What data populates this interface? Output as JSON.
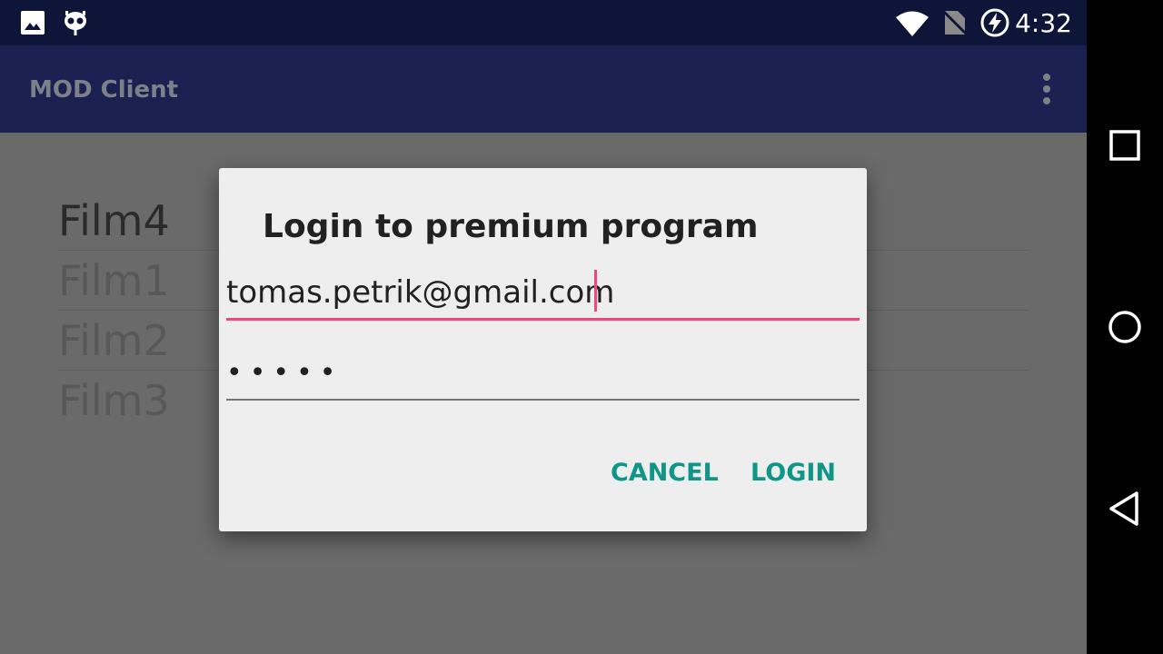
{
  "status_bar": {
    "time": "4:32",
    "icons": [
      "image-icon",
      "cyanogen-icon",
      "wifi-icon",
      "no-sim-icon",
      "battery-charging-icon"
    ]
  },
  "app_bar": {
    "title": "MOD Client",
    "menu_icon": "overflow-menu-icon"
  },
  "film_list": {
    "items": [
      "Film4",
      "Film1",
      "Film2",
      "Film3"
    ]
  },
  "dialog": {
    "title": "Login to premium program",
    "email_value": "tomas.petrik@gmail.com",
    "password_value": "•••••",
    "cancel_label": "CANCEL",
    "login_label": "LOGIN"
  },
  "colors": {
    "status_bar": "#0e1538",
    "app_bar": "#1a2050",
    "accent": "#f0467f",
    "button": "#109688"
  }
}
